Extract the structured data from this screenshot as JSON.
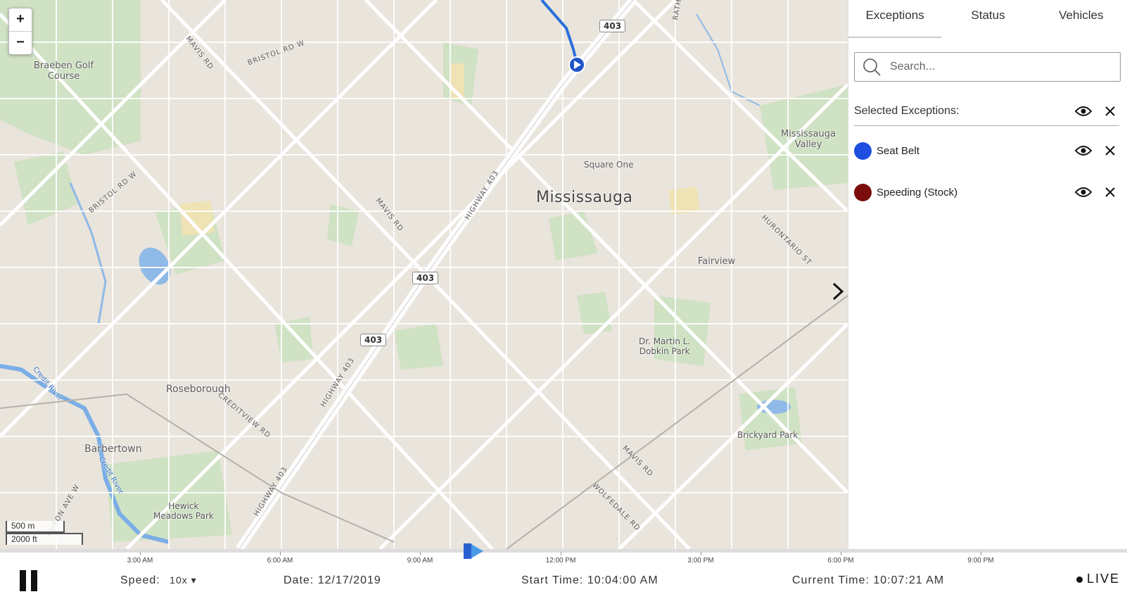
{
  "map": {
    "zoom_in": "+",
    "zoom_out": "−",
    "city_label": "Mississauga",
    "places": [
      {
        "key": "braeben",
        "text": "Braeben Golf\nCourse"
      },
      {
        "key": "square-one",
        "text": "Square One"
      },
      {
        "key": "mississauga-valley",
        "text": "Mississauga\nValley"
      },
      {
        "key": "fairview",
        "text": "Fairview"
      },
      {
        "key": "dobkin",
        "text": "Dr. Martin L.\nDobkin Park"
      },
      {
        "key": "roseborough",
        "text": "Roseborough"
      },
      {
        "key": "barbertown",
        "text": "Barbertown"
      },
      {
        "key": "hewick",
        "text": "Hewick\nMeadows Park"
      },
      {
        "key": "brickyard",
        "text": "Brickyard Park"
      }
    ],
    "roads": [
      {
        "key": "mavis-1",
        "text": "MAVIS RD"
      },
      {
        "key": "bristol-1",
        "text": "BRISTOL RD W"
      },
      {
        "key": "bristol-2",
        "text": "BRISTOL RD W"
      },
      {
        "key": "mavis-2",
        "text": "MAVIS RD"
      },
      {
        "key": "hwy403-1",
        "text": "HIGHWAY 403"
      },
      {
        "key": "hwy403-2",
        "text": "HIGHWAY 403"
      },
      {
        "key": "hwy403-3",
        "text": "HIGHWAY 403"
      },
      {
        "key": "creditview",
        "text": "CREDITVIEW RD"
      },
      {
        "key": "hurontario",
        "text": "HURONTARIO ST"
      },
      {
        "key": "mavis-3",
        "text": "MAVIS RD"
      },
      {
        "key": "wolfedale",
        "text": "WOLFEDALE RD"
      },
      {
        "key": "rath",
        "text": "RATH"
      },
      {
        "key": "credit-river-1",
        "text": "Credit River"
      },
      {
        "key": "credit-river-2",
        "text": "Credit River"
      },
      {
        "key": "huron-w",
        "text": "HURON AVE W"
      }
    ],
    "shields": [
      "403",
      "403",
      "403"
    ],
    "scale_metric": "500 m",
    "scale_imperial": "2000 ft"
  },
  "panel": {
    "tabs": [
      "Exceptions",
      "Status",
      "Vehicles"
    ],
    "search_placeholder": "Search...",
    "selected_header": "Selected Exceptions:",
    "exceptions": [
      {
        "label": "Seat Belt",
        "color": "#1f4fe0"
      },
      {
        "label": "Speeding (Stock)",
        "color": "#7b0d0d"
      }
    ]
  },
  "timeline": {
    "ticks": [
      "3:00 AM",
      "6:00 AM",
      "9:00 AM",
      "12:00 PM",
      "3:00 PM",
      "6:00 PM",
      "9:00 PM"
    ],
    "position_fraction": 0.42,
    "speed_label": "Speed:",
    "speed_value": "10x ▾",
    "date_label": "Date:",
    "date_value": "12/17/2019",
    "start_label": "Start Time:",
    "start_value": "10:04:00 AM",
    "current_label": "Current Time:",
    "current_value": "10:07:21 AM",
    "live_label": "LIVE",
    "accent_color": "#4a8fe7"
  }
}
